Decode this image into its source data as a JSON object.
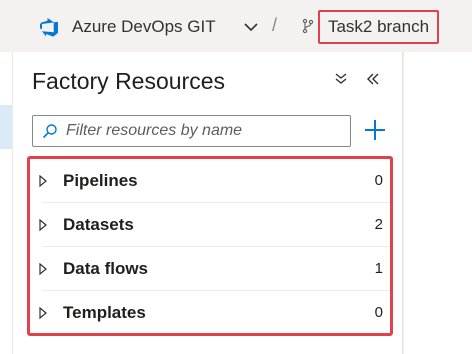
{
  "header": {
    "repo_label": "Azure DevOps GIT",
    "separator": "/",
    "branch_label": "Task2 branch"
  },
  "panel": {
    "title": "Factory Resources",
    "search_placeholder": "Filter resources by name",
    "search_value": "",
    "items": [
      {
        "label": "Pipelines",
        "count": "0"
      },
      {
        "label": "Datasets",
        "count": "2"
      },
      {
        "label": "Data flows",
        "count": "1"
      },
      {
        "label": "Templates",
        "count": "0"
      }
    ]
  },
  "colors": {
    "accent": "#0078d4",
    "highlight_border": "#e1414a"
  },
  "icons": {
    "repo": "azure-devops-icon",
    "repo_dropdown": "chevron-down-icon",
    "branch": "git-branch-icon",
    "collapse_all": "collapse-all-icon",
    "hide_panel": "double-chevron-left-icon",
    "search": "search-icon",
    "add": "plus-icon",
    "expand": "caret-right-icon"
  }
}
